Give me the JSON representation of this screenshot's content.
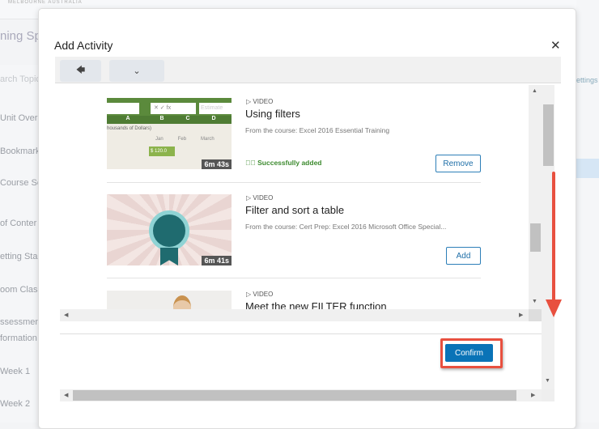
{
  "background": {
    "logo_text": "MELBOURNE AUSTRALIA",
    "page_title_fragment": "ning Spa",
    "search_placeholder": "arch Topic",
    "settings_fragment": "ettings",
    "sidebar_items": [
      "Unit Over",
      "Bookmark",
      "Course Sc",
      "of Conter",
      "etting Sta",
      "oom Class",
      "ssessmen",
      "formation",
      "Week 1",
      "Week 2"
    ]
  },
  "modal": {
    "title": "Add Activity",
    "close_icon": "close-icon",
    "toolbar": {
      "back_icon": "arrow-left-icon",
      "menu_icon": "chevron-down-icon"
    },
    "items": [
      {
        "type": "VIDEO",
        "title": "Using filters",
        "course": "From the course: Excel 2016 Essential Training",
        "duration": "6m 43s",
        "status": "Successfully added",
        "action": "Remove"
      },
      {
        "type": "VIDEO",
        "title": "Filter and sort a table",
        "course": "From the course: Cert Prep: Excel 2016 Microsoft Office Special...",
        "duration": "6m 41s",
        "status": "",
        "action": "Add"
      },
      {
        "type": "VIDEO",
        "title": "Meet the new FILTER function"
      }
    ],
    "thumb1_cells": {
      "cols": [
        "A",
        "B",
        "C",
        "D"
      ],
      "row1": "housands of Dollars)",
      "months": [
        "Jan",
        "Feb",
        "March"
      ],
      "value": "$ 120.0",
      "formula_hint": "Estimate"
    },
    "confirm_label": "Confirm"
  },
  "colors": {
    "primary": "#0a73b7",
    "success": "#3c8a2e",
    "annotation": "#e8503f"
  }
}
